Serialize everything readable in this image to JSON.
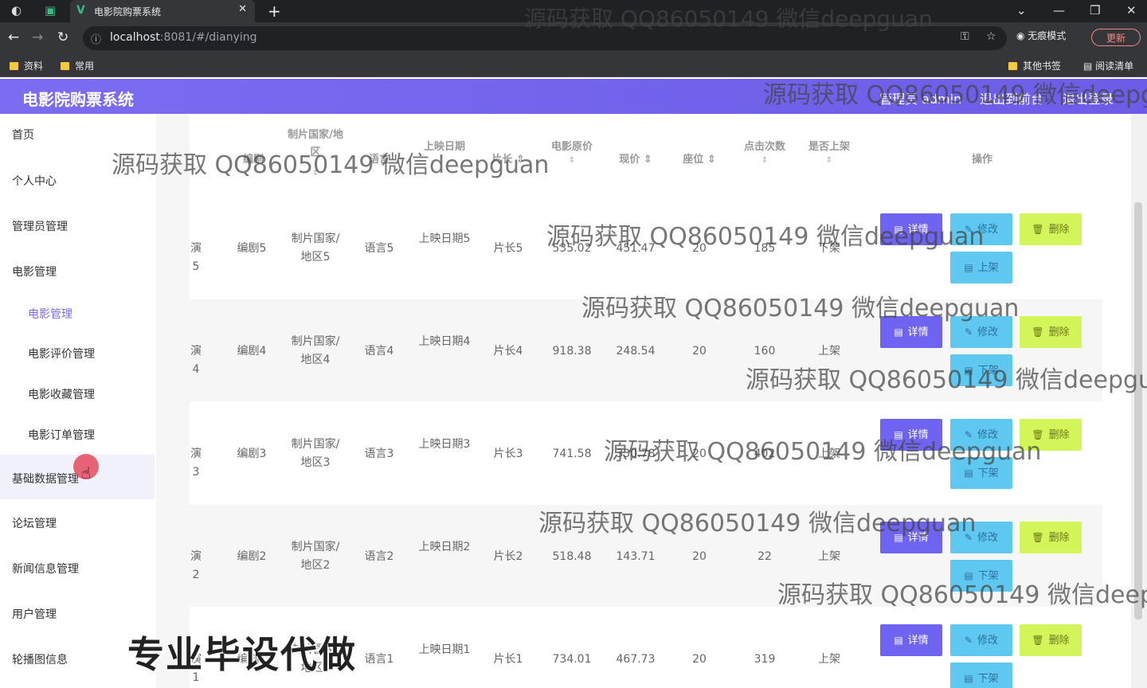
{
  "browser": {
    "tab_title": "电影院购票系统",
    "url_host": "localhost",
    "url_rest": ":8081/#/dianying",
    "incognito_label": "无痕模式",
    "update_label": "更新",
    "bookmarks": [
      "资料",
      "常用"
    ],
    "other_bookmarks": "其他书签",
    "reading_list": "阅读清单"
  },
  "header": {
    "brand": "电影院购票系统",
    "admin": "管理员 admin",
    "back_front": "退出到前台",
    "logout": "退出登录"
  },
  "sidebar": {
    "items": [
      {
        "label": "首页"
      },
      {
        "label": "个人中心"
      },
      {
        "label": "管理员管理"
      },
      {
        "label": "电影管理"
      },
      {
        "label": "电影管理"
      },
      {
        "label": "电影评价管理"
      },
      {
        "label": "电影收藏管理"
      },
      {
        "label": "电影订单管理"
      },
      {
        "label": "基础数据管理"
      },
      {
        "label": "论坛管理"
      },
      {
        "label": "新闻信息管理"
      },
      {
        "label": "用户管理"
      },
      {
        "label": "轮播图信息"
      }
    ]
  },
  "table": {
    "headers": [
      "编剧",
      "制片国家/地区",
      "语言",
      "上映日期",
      "片长",
      "电影原价",
      "现价",
      "座位",
      "点击次数",
      "是否上架",
      "操作"
    ],
    "rows": [
      {
        "first": "演5",
        "writer": "编剧5",
        "country": "制片国家/地区5",
        "lang": "语言5",
        "date": "上映日期5",
        "len": "片长5",
        "orig": "535.02",
        "price": "451.47",
        "seat": "20",
        "clicks": "185",
        "shelf": "下架",
        "shelf_btn": "上架"
      },
      {
        "first": "演4",
        "writer": "编剧4",
        "country": "制片国家/地区4",
        "lang": "语言4",
        "date": "上映日期4",
        "len": "片长4",
        "orig": "918.38",
        "price": "248.54",
        "seat": "20",
        "clicks": "160",
        "shelf": "上架",
        "shelf_btn": "下架"
      },
      {
        "first": "演3",
        "writer": "编剧3",
        "country": "制片国家/地区3",
        "lang": "语言3",
        "date": "上映日期3",
        "len": "片长3",
        "orig": "741.58",
        "price": "330.78",
        "seat": "20",
        "clicks": "402",
        "shelf": "上架",
        "shelf_btn": "下架"
      },
      {
        "first": "演2",
        "writer": "编剧2",
        "country": "制片国家/地区2",
        "lang": "语言2",
        "date": "上映日期2",
        "len": "片长2",
        "orig": "518.48",
        "price": "143.71",
        "seat": "20",
        "clicks": "22",
        "shelf": "上架",
        "shelf_btn": "下架"
      },
      {
        "first": "演1",
        "writer": "编剧1",
        "country": "制片国家/地区1",
        "lang": "语言1",
        "date": "上映日期1",
        "len": "片长1",
        "orig": "734.01",
        "price": "467.73",
        "seat": "20",
        "clicks": "319",
        "shelf": "上架",
        "shelf_btn": "下架"
      }
    ],
    "btn_detail": "详情",
    "btn_edit": "修改",
    "btn_delete": "删除"
  },
  "watermark": "源码获取 QQ86050149 微信deepguan",
  "promo": "专业毕设代做"
}
